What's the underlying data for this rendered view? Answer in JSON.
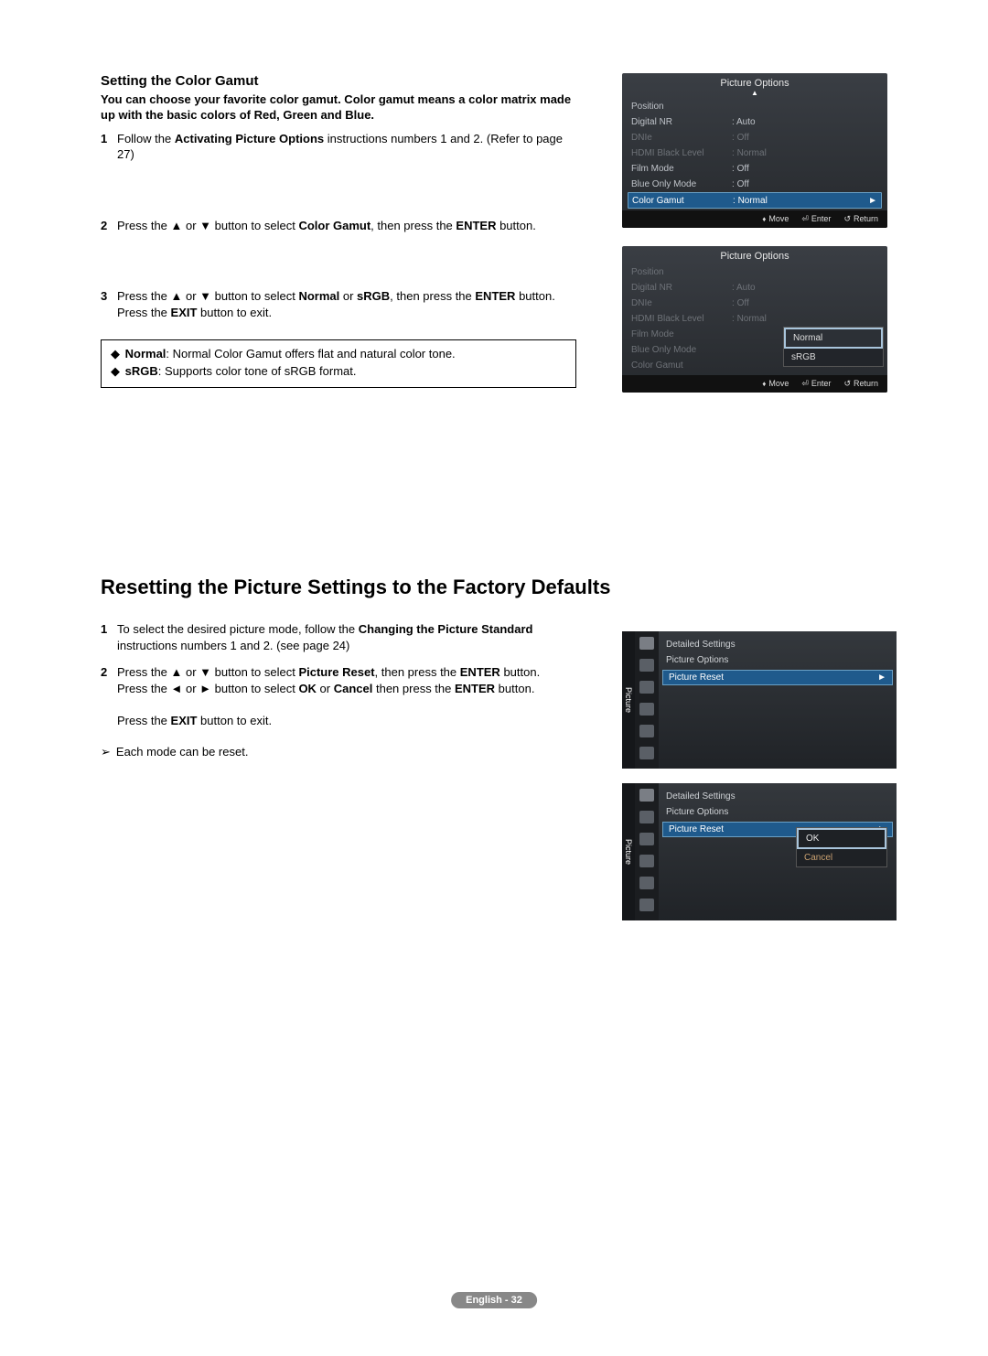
{
  "section1": {
    "heading": "Setting the Color Gamut",
    "intro": "You can choose your favorite color gamut. Color gamut means a color matrix made up with the basic colors of Red, Green and Blue.",
    "steps": [
      {
        "num": "1",
        "plain_before": "Follow the ",
        "bold": "Activating Picture Options",
        "plain_after": " instructions numbers 1 and 2. (Refer to page 27)"
      },
      {
        "num": "2",
        "plain_before": "Press the ▲ or ▼ button to select ",
        "bold": "Color Gamut",
        "plain_after": ", then press the ",
        "bold2": "ENTER",
        "plain_after2": " button."
      },
      {
        "num": "3",
        "plain_before": "Press the ▲ or ▼ button to select ",
        "bold": "Normal",
        "mid": " or ",
        "bold2": "sRGB",
        "plain_after": ", then press the ",
        "bold3": "ENTER",
        "plain_after2": " button. Press the ",
        "bold4": "EXIT",
        "plain_after3": " button to exit."
      }
    ],
    "notes": [
      {
        "term": "Normal",
        "desc": ": Normal Color Gamut offers flat and natural color tone."
      },
      {
        "term": "sRGB",
        "desc": ": Supports color tone of sRGB format."
      }
    ]
  },
  "osd1": {
    "title": "Picture Options",
    "rows": [
      {
        "label": "Position",
        "val": ""
      },
      {
        "label": "Digital NR",
        "val": "Auto"
      },
      {
        "label": "DNIe",
        "val": "Off",
        "dim": true
      },
      {
        "label": "HDMI Black Level",
        "val": "Normal",
        "dim": true
      },
      {
        "label": "Film Mode",
        "val": "Off"
      },
      {
        "label": "Blue Only Mode",
        "val": "Off"
      },
      {
        "label": "Color Gamut",
        "val": "Normal",
        "selected": true
      }
    ],
    "footer": {
      "move": "Move",
      "enter": "Enter",
      "ret": "Return"
    }
  },
  "osd2": {
    "title": "Picture Options",
    "rows": [
      {
        "label": "Position",
        "val": "",
        "dim": true
      },
      {
        "label": "Digital NR",
        "val": "Auto",
        "dim": true
      },
      {
        "label": "DNIe",
        "val": "Off",
        "dim": true
      },
      {
        "label": "HDMI Black Level",
        "val": "Normal",
        "dim": true
      },
      {
        "label": "Film Mode",
        "val": "",
        "dim": true
      },
      {
        "label": "Blue Only Mode",
        "val": "",
        "dim": true
      },
      {
        "label": "Color Gamut",
        "val": "",
        "dim": true
      }
    ],
    "popup": [
      "Normal",
      "sRGB"
    ],
    "footer": {
      "move": "Move",
      "enter": "Enter",
      "ret": "Return"
    }
  },
  "section2": {
    "heading": "Resetting the Picture Settings to the Factory Defaults",
    "steps": [
      {
        "num": "1",
        "plain_before": "To select the desired picture mode, follow the ",
        "bold": "Changing the Picture Standard",
        "plain_after": " instructions numbers 1 and 2. (see page 24)"
      },
      {
        "num": "2",
        "lines": [
          {
            "a": "Press the ▲ or ▼ button to select ",
            "b": "Picture Reset",
            "c": ", then press the ",
            "d": "ENTER",
            "e": " button."
          },
          {
            "a": "Press the ◄ or ► button to select ",
            "b": "OK",
            "c": " or ",
            "d": "Cancel",
            "e": " then press the ",
            "f": "ENTER",
            "g": " button."
          },
          {
            "a": "Press the ",
            "b": "EXIT",
            "c": " button to exit."
          }
        ]
      }
    ],
    "note": "Each mode can be reset."
  },
  "osd3": {
    "tab": "Picture",
    "items": [
      "Detailed Settings",
      "Picture Options",
      "Picture Reset"
    ]
  },
  "osd4": {
    "tab": "Picture",
    "items": [
      "Detailed Settings",
      "Picture Options",
      "Picture Reset"
    ],
    "popup": [
      "OK",
      "Cancel"
    ]
  },
  "footer": "English - 32"
}
